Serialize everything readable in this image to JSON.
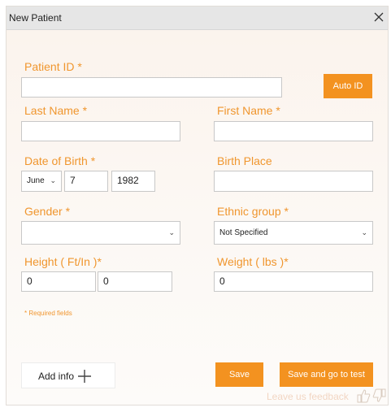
{
  "window": {
    "title": "New Patient"
  },
  "form": {
    "patient_id": {
      "label": "Patient ID *",
      "value": ""
    },
    "auto_id_label": "Auto ID",
    "last_name": {
      "label": "Last Name  *",
      "value": ""
    },
    "first_name": {
      "label": "First Name *",
      "value": ""
    },
    "date_of_birth": {
      "label": "Date of Birth *",
      "month": "June",
      "day": "7",
      "year": "1982"
    },
    "birth_place": {
      "label": "Birth Place",
      "value": ""
    },
    "gender": {
      "label": "Gender *",
      "value": ""
    },
    "ethnic_group": {
      "label": "Ethnic group *",
      "value": "Not Specified"
    },
    "height": {
      "label": "Height  ( Ft/In )*",
      "feet": "0",
      "inches": "0"
    },
    "weight": {
      "label": "Weight  ( lbs )*",
      "value": "0"
    },
    "required_note": "* Required fields"
  },
  "footer": {
    "add_info_label": "Add info",
    "save_label": "Save",
    "save_and_test_label": "Save and go to test",
    "feedback_label": "Leave us feedback"
  },
  "icons": {
    "close": "close-icon",
    "plus": "plus-icon",
    "dropdown": "chevron-down-icon",
    "thumbs_up": "thumbs-up-icon",
    "thumbs_down": "thumbs-down-icon"
  },
  "colors": {
    "accent": "#f39220",
    "label": "#f0962e",
    "titlebar": "#e6e6e6"
  }
}
